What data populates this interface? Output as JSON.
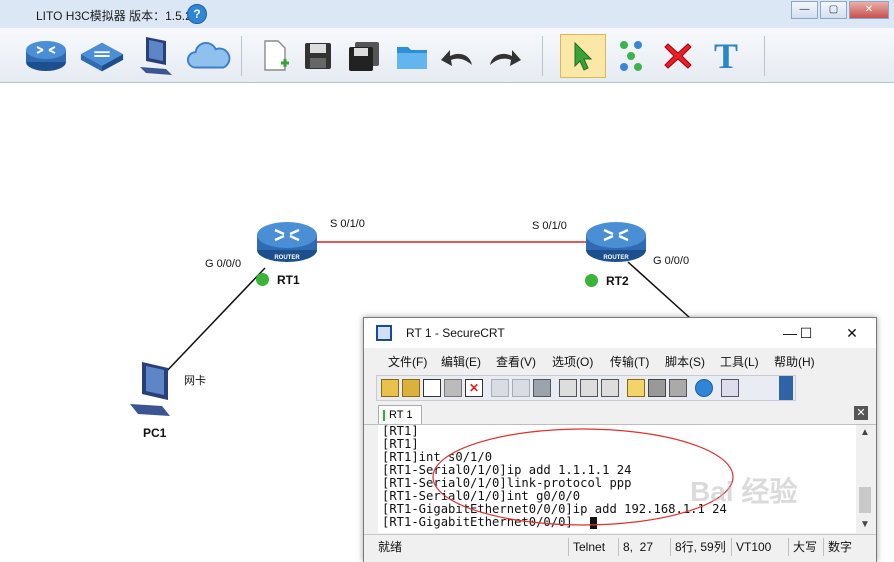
{
  "app": {
    "title": "LITO H3C模拟器 版本：1.5.2",
    "help_glyph": "?",
    "window_buttons": {
      "minimize": "—",
      "maximize": "▢",
      "close": "✕"
    }
  },
  "toolbar": {
    "items": [
      {
        "name": "router-tool",
        "icon": "router-icon"
      },
      {
        "name": "switch-tool",
        "icon": "switch-icon"
      },
      {
        "name": "pc-tool",
        "icon": "pc-icon"
      },
      {
        "name": "cloud-tool",
        "icon": "cloud-icon"
      },
      {
        "name": "new-file-tool",
        "icon": "new-file-icon"
      },
      {
        "name": "save-tool",
        "icon": "save-icon"
      },
      {
        "name": "save-as-tool",
        "icon": "save-as-icon"
      },
      {
        "name": "open-folder-tool",
        "icon": "folder-icon"
      },
      {
        "name": "undo-tool",
        "icon": "undo-icon"
      },
      {
        "name": "redo-tool",
        "icon": "redo-icon"
      },
      {
        "name": "select-tool",
        "icon": "pointer-icon"
      },
      {
        "name": "connect-tool",
        "icon": "connect-icon"
      },
      {
        "name": "delete-tool",
        "icon": "delete-icon"
      },
      {
        "name": "text-tool",
        "icon": "text-icon"
      }
    ],
    "text_glyph": "T"
  },
  "topology": {
    "devices": {
      "rt1": {
        "name": "RT1",
        "label": "ROUTER",
        "status_color": "#39b539"
      },
      "rt2": {
        "name": "RT2",
        "label": "ROUTER",
        "status_color": "#39b539"
      },
      "pc1": {
        "name": "PC1",
        "nic_label": "网卡"
      }
    },
    "interfaces": {
      "rt1_serial": "S 0/1/0",
      "rt2_serial": "S 0/1/0",
      "rt1_gig": "G 0/0/0",
      "rt2_gig": "G 0/0/0"
    },
    "serial_link_color": "#e02020"
  },
  "securecrt": {
    "title": "RT 1 - SecureCRT",
    "window_buttons": {
      "minimize": "—",
      "maximize": "☐",
      "close": "✕"
    },
    "menu": [
      "文件(F)",
      "编辑(E)",
      "查看(V)",
      "选项(O)",
      "传输(T)",
      "脚本(S)",
      "工具(L)",
      "帮助(H)"
    ],
    "tab": "RT 1",
    "tab_close": "✕",
    "terminal_lines": [
      "[RT1]",
      "[RT1]",
      "[RT1]int s0/1/0",
      "[RT1-Serial0/1/0]ip add 1.1.1.1 24",
      "[RT1-Serial0/1/0]link-protocol ppp",
      "[RT1-Serial0/1/0]int g0/0/0",
      "[RT1-GigabitEthernet0/0/0]ip add 192.168.1.1 24",
      "[RT1-GigabitEthernet0/0/0]"
    ],
    "status": {
      "ready": "就绪",
      "protocol": "Telnet",
      "cursor": "8,  27",
      "rows_cols": "8行, 59列",
      "emulation": "VT100",
      "caps": "大写",
      "num": "数字"
    },
    "annotation_color": "#e03030"
  },
  "watermark": "Bai 经验"
}
